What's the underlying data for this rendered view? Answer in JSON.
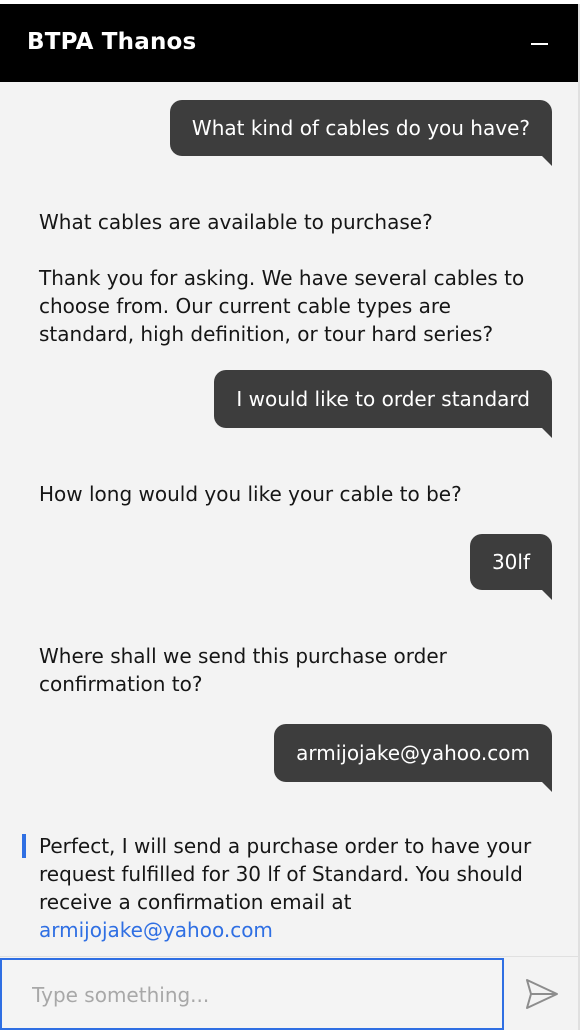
{
  "header": {
    "title": "BTPA Thanos",
    "minimize_icon": "minimize-icon"
  },
  "messages": {
    "m1_user": "What kind of cables do you have?",
    "m2_bot_question": "What cables are available to purchase?",
    "m2_bot_answer": "Thank you for asking. We have several cables to choose from. Our current cable types are standard, high definition, or tour hard series?",
    "m3_user": "I would like to order standard",
    "m4_bot": "How long would you like your cable to be?",
    "m5_user": "30lf",
    "m6_bot": "Where shall we send this purchase order confirmation to?",
    "m7_user": "armijojake@yahoo.com",
    "m8_bot_text": "Perfect, I will send a purchase order to have your request fulfilled for 30 lf of Standard. You should receive a confirmation email at",
    "m8_bot_link": "armijojake@yahoo.com"
  },
  "composer": {
    "placeholder": "Type something...",
    "value": "",
    "send_icon": "send-icon"
  },
  "colors": {
    "header_bg": "#000000",
    "user_bubble": "#3d3d3d",
    "accent": "#2f6fe3",
    "panel_bg": "#f3f3f3"
  }
}
